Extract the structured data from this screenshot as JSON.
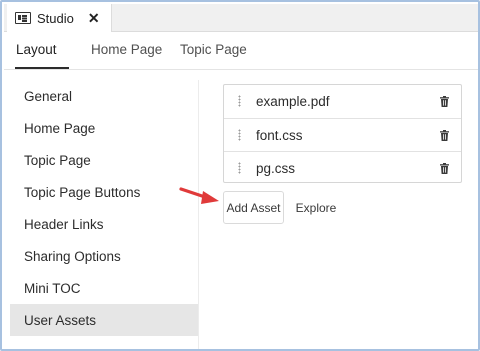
{
  "window": {
    "tab_title": "Studio",
    "close_symbol": "✕",
    "tab_icon": "panel-icon"
  },
  "subtabs": [
    {
      "label": "Layout",
      "active": true
    },
    {
      "label": "Home Page",
      "active": false
    },
    {
      "label": "Topic Page",
      "active": false
    }
  ],
  "sidebar": {
    "items": [
      {
        "label": "General",
        "selected": false
      },
      {
        "label": "Home Page",
        "selected": false
      },
      {
        "label": "Topic Page",
        "selected": false
      },
      {
        "label": "Topic Page Buttons",
        "selected": false
      },
      {
        "label": "Header Links",
        "selected": false
      },
      {
        "label": "Sharing Options",
        "selected": false
      },
      {
        "label": "Mini TOC",
        "selected": false
      },
      {
        "label": "User Assets",
        "selected": true
      }
    ]
  },
  "assets": {
    "items": [
      {
        "name": "example.pdf",
        "icon": "trash-icon"
      },
      {
        "name": "font.css",
        "icon": "trash-icon"
      },
      {
        "name": "pg.css",
        "icon": "trash-icon"
      }
    ]
  },
  "actions": {
    "add_asset_label": "Add Asset",
    "explore_label": "Explore"
  },
  "annotation": {
    "arrow_color": "#e03a3a"
  },
  "colors": {
    "frame_border": "#a7c1e0",
    "selected_bg": "#e6e6e6"
  }
}
